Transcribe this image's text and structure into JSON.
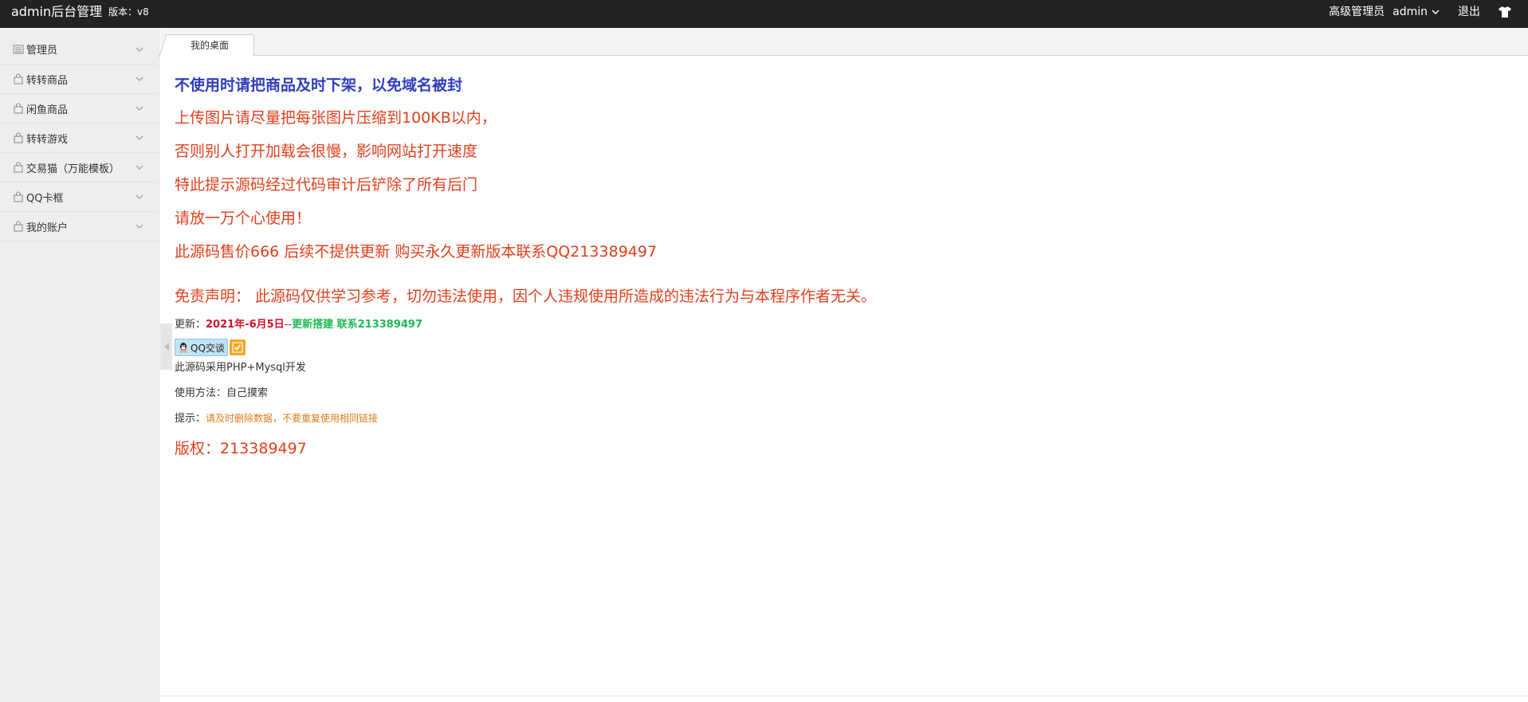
{
  "header": {
    "brand": "admin后台管理",
    "version": "版本：v8",
    "role": "高级管理员",
    "username": "admin",
    "logout": "退出"
  },
  "sidebar": {
    "items": [
      {
        "label": "管理员"
      },
      {
        "label": "转转商品"
      },
      {
        "label": "闲鱼商品"
      },
      {
        "label": "转转游戏"
      },
      {
        "label": "交易猫（万能模板）"
      },
      {
        "label": "QQ卡框"
      },
      {
        "label": "我的账户"
      }
    ]
  },
  "tabs": [
    {
      "label": "我的桌面"
    }
  ],
  "main": {
    "title": "不使用时请把商品及时下架，以免域名被封",
    "lines": [
      "上传图片请尽量把每张图片压缩到100KB以内，",
      "否则别人打开加载会很慢，影响网站打开速度",
      "特此提示源码经过代码审计后铲除了所有后门",
      "请放一万个心使用！",
      "此源码售价666 后续不提供更新 购买永久更新版本联系QQ213389497"
    ],
    "disclaimer": "免责声明：  此源码仅供学习参考，切勿违法使用，因个人违规使用所造成的违法行为与本程序作者无关。",
    "update_label": "更新：",
    "update_date": "2021年-6月5日",
    "update_sep": "--",
    "update_note": "更新搭建 联系213389497",
    "qq_button": "QQ交谈",
    "php": "此源码采用PHP+Mysql开发",
    "usage": "使用方法：自己摸索",
    "tip_label": "提示：",
    "tip_text": "请及时删除数据，不要重复使用相同链接",
    "copyright": "版权：213389497"
  }
}
